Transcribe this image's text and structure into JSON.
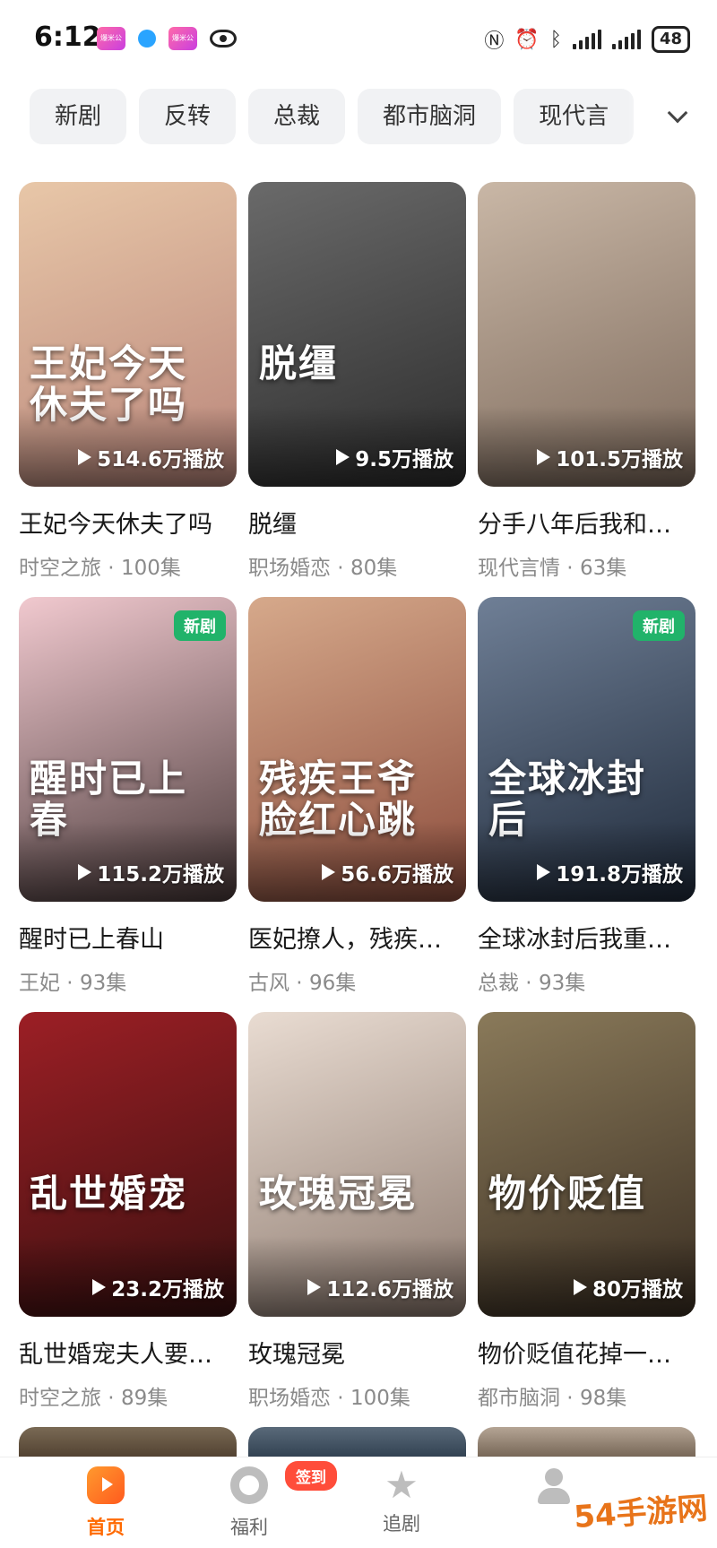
{
  "status_bar": {
    "time": "6:12",
    "app_icon_label": "爆米公",
    "battery": "48"
  },
  "filters": [
    "新剧",
    "反转",
    "总裁",
    "都市脑洞",
    "现代言"
  ],
  "cards": [
    {
      "title": "王妃今天休夫了吗",
      "genre": "时空之旅",
      "episodes": "100集",
      "plays": "514.6万播放",
      "poster_text": "王妃今天休夫了吗",
      "badge": "",
      "colors": [
        "#e8c7a8",
        "#b9857a"
      ]
    },
    {
      "title": "脱缰",
      "genre": "职场婚恋",
      "episodes": "80集",
      "plays": "9.5万播放",
      "poster_text": "脱缰",
      "badge": "",
      "colors": [
        "#6a6a6a",
        "#2c2c2c"
      ]
    },
    {
      "title": "分手八年后我和…",
      "genre": "现代言情",
      "episodes": "63集",
      "plays": "101.5万播放",
      "poster_text": "",
      "badge": "",
      "colors": [
        "#c9b7a6",
        "#7d6a5c"
      ]
    },
    {
      "title": "醒时已上春山",
      "genre": "王妃",
      "episodes": "93集",
      "plays": "115.2万播放",
      "poster_text": "醒时已上春",
      "badge": "新剧",
      "colors": [
        "#f1c9cf",
        "#4a3a3a"
      ]
    },
    {
      "title": "医妃撩人，残疾…",
      "genre": "古风",
      "episodes": "96集",
      "plays": "56.6万播放",
      "poster_text": "残疾王爷脸红心跳",
      "badge": "",
      "colors": [
        "#d6a98b",
        "#8c4c3c"
      ]
    },
    {
      "title": "全球冰封后我重…",
      "genre": "总裁",
      "episodes": "93集",
      "plays": "191.8万播放",
      "poster_text": "全球冰封后",
      "badge": "新剧",
      "colors": [
        "#6f7f96",
        "#1f2a3a"
      ]
    },
    {
      "title": "乱世婚宠夫人要…",
      "genre": "时空之旅",
      "episodes": "89集",
      "plays": "23.2万播放",
      "poster_text": "乱世婚宠",
      "badge": "",
      "colors": [
        "#9c1f25",
        "#3a1010"
      ]
    },
    {
      "title": "玫瑰冠冕",
      "genre": "职场婚恋",
      "episodes": "100集",
      "plays": "112.6万播放",
      "poster_text": "玫瑰冠冕",
      "badge": "",
      "colors": [
        "#e9dcd2",
        "#8d7a6f"
      ]
    },
    {
      "title": "物价贬值花掉一…",
      "genre": "都市脑洞",
      "episodes": "98集",
      "plays": "80万播放",
      "poster_text": "物价贬值",
      "badge": "",
      "colors": [
        "#8a7a5a",
        "#3a2e22"
      ]
    }
  ],
  "meta_separator": " · ",
  "tabs": [
    {
      "label": "首页",
      "icon": "home-icon",
      "active": true
    },
    {
      "label": "福利",
      "icon": "gift-icon",
      "active": false
    },
    {
      "label": "追剧",
      "icon": "star-icon",
      "active": false
    },
    {
      "label": "",
      "icon": "user-icon",
      "active": false
    }
  ],
  "checkin_badge": "签到",
  "watermark": "54手游网"
}
